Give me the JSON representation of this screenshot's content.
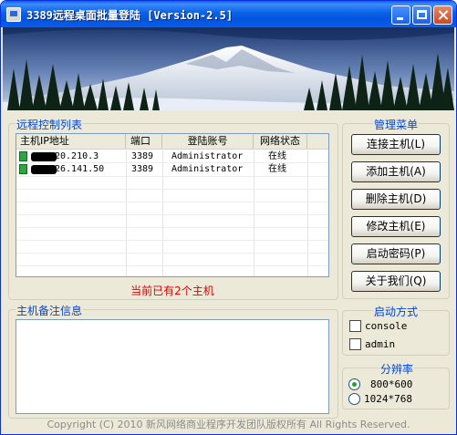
{
  "window": {
    "title": "3389远程桌面批量登陆 [Version-2.5]",
    "controls": [
      "minimize",
      "maximize",
      "close"
    ]
  },
  "host_list": {
    "group_title": "远程控制列表",
    "columns": [
      "主机IP地址",
      "端口",
      "登陆账号",
      "网络状态"
    ],
    "rows": [
      {
        "ip": "20.210.3",
        "port": "3389",
        "account": "Administrator",
        "status": "在线",
        "icon": "computer-online-icon"
      },
      {
        "ip": "26.141.50",
        "port": "3389",
        "account": "Administrator",
        "status": "在线",
        "icon": "computer-online-icon"
      }
    ],
    "count_text": "当前已有2个主机"
  },
  "menu": {
    "group_title": "管理菜单",
    "buttons": [
      "连接主机(L)",
      "添加主机(A)",
      "删除主机(D)",
      "修改主机(E)",
      "启动密码(P)",
      "关于我们(Q)"
    ]
  },
  "notes": {
    "group_title": "主机备注信息",
    "value": ""
  },
  "launch": {
    "group_title": "启动方式",
    "options": [
      {
        "label": "console",
        "checked": false
      },
      {
        "label": "admin",
        "checked": false
      }
    ]
  },
  "resolution": {
    "group_title": "分辨率",
    "options": [
      {
        "label": "800*600",
        "selected": true
      },
      {
        "label": "1024*768",
        "selected": false
      }
    ]
  },
  "footer": {
    "copyright": "Copyright (C) 2010 新风网络商业程序开发团队版权所有 All Rights Reserved."
  },
  "colors": {
    "titlebar": "#0a5ff0",
    "group_title": "#0046d5",
    "count_text": "#e00000",
    "online_icon": "#2fa640"
  }
}
